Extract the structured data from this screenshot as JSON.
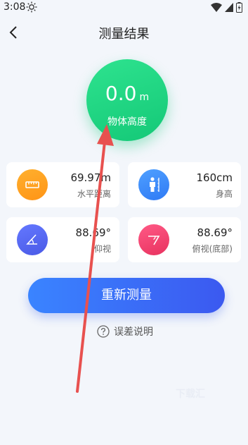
{
  "status": {
    "time": "3:08"
  },
  "header": {
    "title": "测量结果"
  },
  "result": {
    "value": "0.0",
    "unit": "m",
    "label": "物体高度"
  },
  "cards": [
    {
      "value": "69.97m",
      "label": "水平距离",
      "icon": "ruler-icon",
      "color": "#ffa21f"
    },
    {
      "value": "160cm",
      "label": "身高",
      "icon": "person-height-icon",
      "color": "#3b8cff"
    },
    {
      "value": "88.69°",
      "label": "仰视",
      "icon": "elevation-angle-icon",
      "color": "#5466f0"
    },
    {
      "value": "88.69°",
      "label": "俯视(底部)",
      "icon": "depression-angle-icon",
      "color": "#f0436f"
    }
  ],
  "actions": {
    "remeasure": "重新测量",
    "error_explanation": "误差说明"
  },
  "watermark": "下载汇"
}
